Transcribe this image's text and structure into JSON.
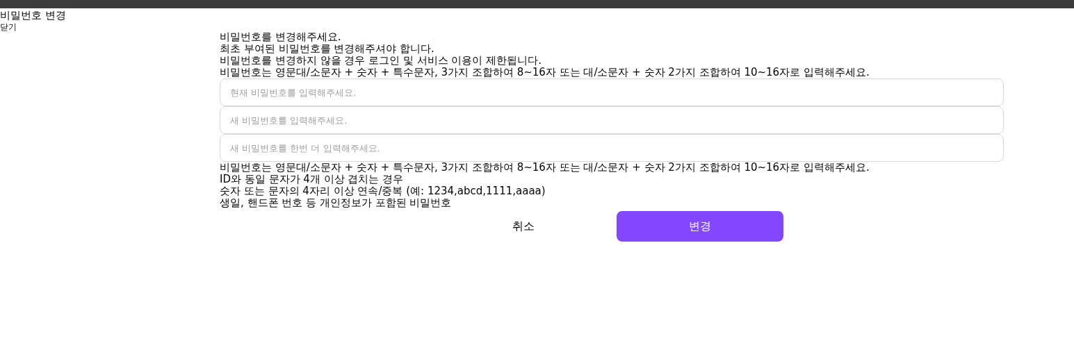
{
  "header": {
    "title": "비밀번호 변경",
    "back_link": "닫기"
  },
  "notice": [
    "비밀번호를 변경해주세요.",
    "최초 부여된 비밀번호를 변경해주셔야 합니다.",
    "비밀번호를 변경하지 않을 경우 로그인 및 서비스 이용이 제한됩니다.",
    "비밀번호는 영문대/소문자 + 숫자 + 특수문자, 3가지 조합하여 8~16자 또는 대/소문자 + 숫자 2가지 조합하여 10~16자로 입력해주세요."
  ],
  "fields": [
    {
      "placeholder": "현재 비밀번호를 입력해주세요."
    },
    {
      "placeholder": "새 비밀번호를 입력해주세요."
    },
    {
      "placeholder": "새 비밀번호를 한번 더 입력해주세요."
    }
  ],
  "rules": [
    "비밀번호는 영문대/소문자 + 숫자 + 특수문자, 3가지 조합하여 8~16자 또는 대/소문자 + 숫자 2가지 조합하여 10~16자로 입력해주세요.",
    "ID와 동일 문자가 4개 이상 겹치는 경우",
    "숫자 또는 문자의 4자리 이상 연속/중복 (예: 1234,abcd,1111,aaaa)",
    "생일, 핸드폰 번호 등 개인정보가 포함된 비밀번호"
  ],
  "buttons": [
    {
      "label": "취소",
      "kind": "plain"
    },
    {
      "label": "변경",
      "kind": "primary"
    }
  ]
}
